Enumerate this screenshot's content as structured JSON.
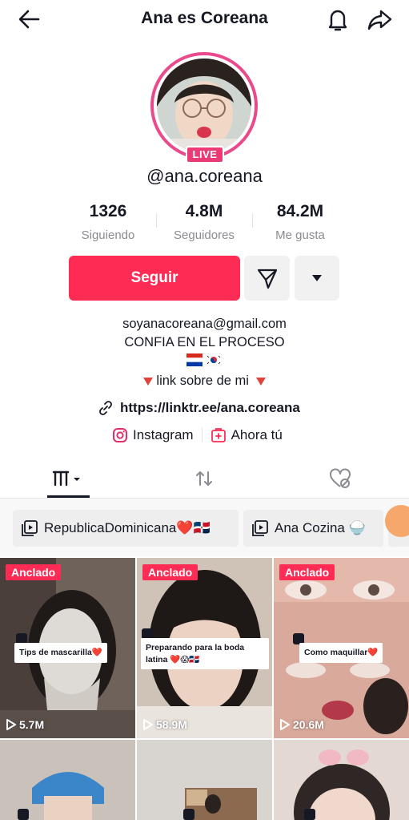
{
  "header": {
    "title": "Ana es Coreana",
    "back_icon": "arrow-left-icon",
    "bell_icon": "bell-icon",
    "share_icon": "share-arrow-icon"
  },
  "profile": {
    "live_badge": "LIVE",
    "username": "@ana.coreana",
    "ring_color": "#ea4a8c"
  },
  "stats": [
    {
      "value": "1326",
      "label": "Siguiendo"
    },
    {
      "value": "4.8M",
      "label": "Seguidores"
    },
    {
      "value": "84.2M",
      "label": "Me gusta"
    }
  ],
  "actions": {
    "follow_label": "Seguir",
    "follow_color": "#fe2c55",
    "message_icon": "send-icon",
    "more_icon": "caret-down-icon"
  },
  "bio": {
    "email": "soyanacoreana@gmail.com",
    "motto": "CONFIA EN EL PROCESO",
    "flags": [
      "paraguay-flag-icon",
      "south-korea-flag-icon"
    ],
    "link_hint": "link sobre de mi",
    "url": "https://linktr.ee/ana.coreana",
    "instagram_label": "Instagram",
    "ahora_label": "Ahora tú"
  },
  "tabs": [
    {
      "icon": "videos-grid-icon",
      "active": true
    },
    {
      "icon": "repost-icon",
      "active": false
    },
    {
      "icon": "liked-hidden-icon",
      "active": false
    }
  ],
  "playlists": [
    {
      "label": "RepublicaDominicana❤️🇩🇴"
    },
    {
      "label": "Ana Cozina 🍚"
    }
  ],
  "videos": [
    {
      "pinned": "Anclado",
      "caption": "Tips de mascarilla❤️",
      "views": "5.7M"
    },
    {
      "pinned": "Anclado",
      "caption": "Preparando para la boda latina ❤️😱🇩🇴",
      "views": "58.9M"
    },
    {
      "pinned": "Anclado",
      "caption": "Como maquillar❤️",
      "views": "20.6M"
    }
  ]
}
